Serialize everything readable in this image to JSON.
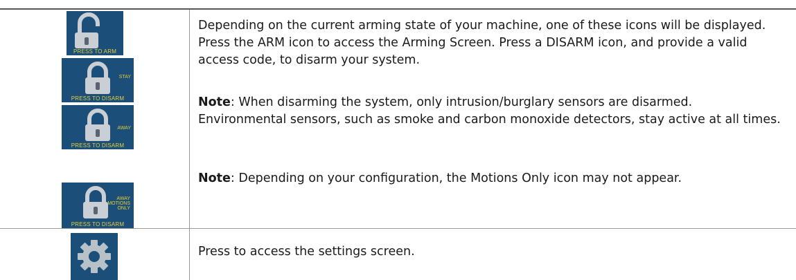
{
  "icons": {
    "arm": {
      "caption": "PRESS TO ARM"
    },
    "disarm_stay": {
      "caption": "PRESS TO DISARM",
      "side": [
        "STAY"
      ]
    },
    "disarm_away": {
      "caption": "PRESS TO DISARM",
      "side": [
        "AWAY"
      ]
    },
    "disarm_motions": {
      "caption": "PRESS TO DISARM",
      "side": [
        "AWAY",
        "MOTIONS",
        "ONLY"
      ]
    },
    "settings": {
      "icon": "gear-icon"
    }
  },
  "row1": {
    "paragraph": "Depending on the current arming state of your machine, one of these icons will be displayed. Press the ARM icon to access the Arming Screen. Press a DISARM icon, and provide a valid access code, to disarm your system.",
    "note1_label": "Note",
    "note1_text": ": When disarming the system, only intrusion/burglary sensors are disarmed. Environmental sensors, such as smoke and carbon monoxide detectors, stay active at all times.",
    "note2_label": "Note",
    "note2_text": ": Depending on your configuration, the Motions Only icon may not appear."
  },
  "row2": {
    "paragraph": "Press to access the settings screen."
  },
  "colors": {
    "tile_bg": "#1b4f7a",
    "caption": "#e6cf33",
    "lock": "#c9cfd4"
  }
}
